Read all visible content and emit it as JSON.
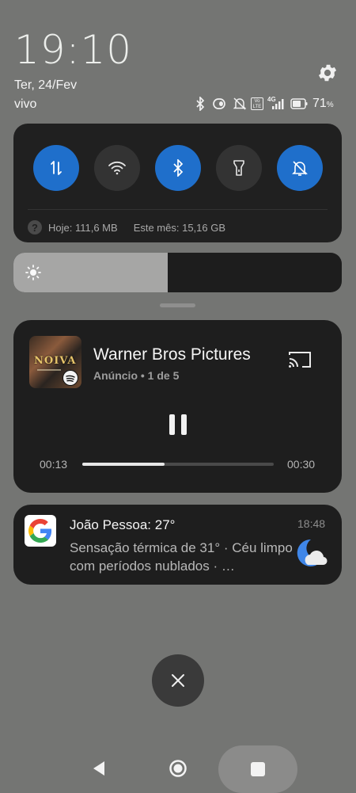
{
  "header": {
    "clock": "19:10",
    "date": "Ter, 24/Fev",
    "carrier": "vivo",
    "settings_icon": "gear-icon"
  },
  "status_bar": {
    "icons": [
      "bluetooth-icon",
      "vibrate-icon",
      "bell-off-icon",
      "volte-icon",
      "4g-signal-icon"
    ],
    "volte_label": "Vo LTE",
    "network_label": "4G",
    "battery": "71",
    "battery_unit": "%"
  },
  "quick_settings": {
    "toggles": [
      {
        "name": "mobile-data",
        "icon": "swap-vertical-icon",
        "state": "on"
      },
      {
        "name": "wifi",
        "icon": "wifi-icon",
        "state": "off"
      },
      {
        "name": "bluetooth",
        "icon": "bluetooth-icon",
        "state": "on"
      },
      {
        "name": "flashlight",
        "icon": "flashlight-icon",
        "state": "off"
      },
      {
        "name": "silent",
        "icon": "bell-off-icon",
        "state": "on"
      }
    ],
    "usage_icon": "?",
    "usage_today": "Hoje: 111,6 MB",
    "usage_month": "Este mês: 15,16 GB"
  },
  "brightness": {
    "level_fraction": 0.47,
    "icon": "sun-icon"
  },
  "media": {
    "title": "Warner Bros Pictures",
    "subtitle": "Anúncio • 1 de 5",
    "album_text": "NOIVA",
    "cast_icon": "cast-icon",
    "pause_icon": "pause-icon",
    "spotify_icon": "spotify-icon",
    "time_elapsed": "00:13",
    "time_total": "00:30",
    "progress_fraction": 0.43
  },
  "weather": {
    "title": "João Pessoa: 27°",
    "time": "18:48",
    "body": "Sensação térmica de 31° · Céu limpo com períodos nublados · …",
    "icon": "moon-cloud-icon",
    "app_icon": "google-icon"
  },
  "controls": {
    "close_icon": "close-icon"
  },
  "navigation": {
    "back": "back-triangle-icon",
    "home": "home-circle-icon",
    "recents": "recents-square-icon"
  },
  "colors": {
    "accent": "#1f6fcb",
    "panel": "#202020",
    "background": "#747573"
  }
}
